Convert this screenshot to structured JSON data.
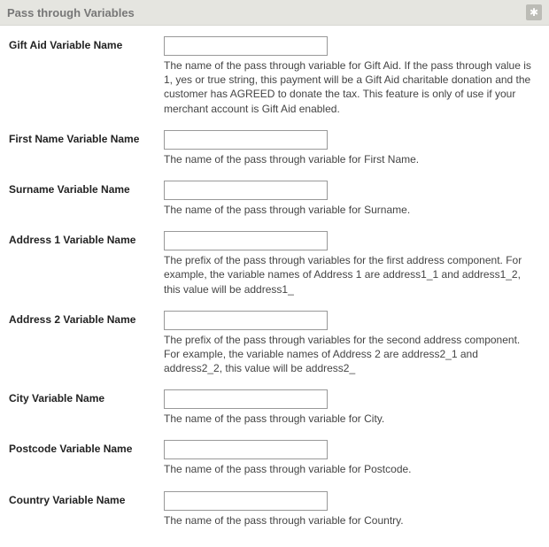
{
  "panel": {
    "title": "Pass through Variables",
    "star_icon": "✱"
  },
  "fields": {
    "gift_aid": {
      "label": "Gift Aid Variable Name",
      "value": "",
      "help": "The name of the pass through variable for Gift Aid. If the pass through value is 1, yes or true string, this payment will be a Gift Aid charitable donation and the customer has AGREED to donate the tax. This feature is only of use if your merchant account is Gift Aid enabled."
    },
    "first_name": {
      "label": "First Name Variable Name",
      "value": "",
      "help": "The name of the pass through variable for First Name."
    },
    "surname": {
      "label": "Surname Variable Name",
      "value": "",
      "help": "The name of the pass through variable for Surname."
    },
    "address1": {
      "label": "Address 1 Variable Name",
      "value": "",
      "help": "The prefix of the pass through variables for the first address component. For example, the variable names of Address 1 are address1_1 and address1_2, this value will be address1_"
    },
    "address2": {
      "label": "Address 2 Variable Name",
      "value": "",
      "help": "The prefix of the pass through variables for the second address component. For example, the variable names of Address 2 are address2_1 and address2_2, this value will be address2_"
    },
    "city": {
      "label": "City Variable Name",
      "value": "",
      "help": "The name of the pass through variable for City."
    },
    "postcode": {
      "label": "Postcode Variable Name",
      "value": "",
      "help": "The name of the pass through variable for Postcode."
    },
    "country": {
      "label": "Country Variable Name",
      "value": "",
      "help": "The name of the pass through variable for Country."
    }
  }
}
